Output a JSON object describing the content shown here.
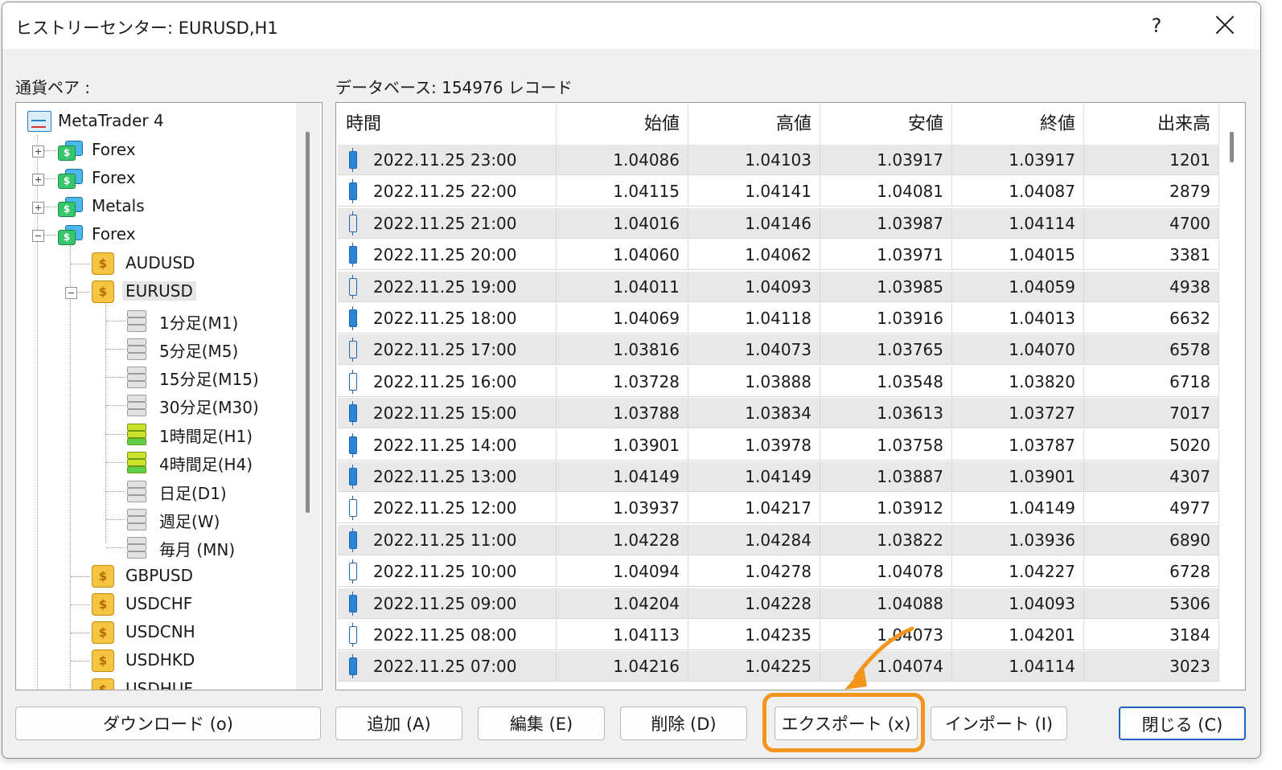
{
  "window": {
    "title": "ヒストリーセンター: EURUSD,H1",
    "help_label": "?",
    "close_icon": "close-icon"
  },
  "left_label": "通貨ペア :",
  "right_label": "データベース: 154976 レコード",
  "tree": {
    "root": "MetaTrader 4",
    "groups": [
      "Forex",
      "Forex",
      "Metals",
      "Forex"
    ],
    "symbols_before": [
      "AUDUSD",
      "EURUSD"
    ],
    "timeframes": [
      "1分足(M1)",
      "5分足(M5)",
      "15分足(M15)",
      "30分足(M30)",
      "1時間足(H1)",
      "4時間足(H4)",
      "日足(D1)",
      "週足(W)",
      "毎月 (MN)"
    ],
    "symbols_after": [
      "GBPUSD",
      "USDCHF",
      "USDCNH",
      "USDHKD",
      "USDHUF"
    ],
    "coin_glyph": "$"
  },
  "grid": {
    "headers": [
      "時間",
      "始値",
      "高値",
      "安値",
      "終値",
      "出来高"
    ],
    "rows": [
      {
        "time": "2022.11.25 23:00",
        "open": "1.04086",
        "high": "1.04103",
        "low": "1.03917",
        "close": "1.03917",
        "volume": "1201"
      },
      {
        "time": "2022.11.25 22:00",
        "open": "1.04115",
        "high": "1.04141",
        "low": "1.04081",
        "close": "1.04087",
        "volume": "2879"
      },
      {
        "time": "2022.11.25 21:00",
        "open": "1.04016",
        "high": "1.04146",
        "low": "1.03987",
        "close": "1.04114",
        "volume": "4700"
      },
      {
        "time": "2022.11.25 20:00",
        "open": "1.04060",
        "high": "1.04062",
        "low": "1.03971",
        "close": "1.04015",
        "volume": "3381"
      },
      {
        "time": "2022.11.25 19:00",
        "open": "1.04011",
        "high": "1.04093",
        "low": "1.03985",
        "close": "1.04059",
        "volume": "4938"
      },
      {
        "time": "2022.11.25 18:00",
        "open": "1.04069",
        "high": "1.04118",
        "low": "1.03916",
        "close": "1.04013",
        "volume": "6632"
      },
      {
        "time": "2022.11.25 17:00",
        "open": "1.03816",
        "high": "1.04073",
        "low": "1.03765",
        "close": "1.04070",
        "volume": "6578"
      },
      {
        "time": "2022.11.25 16:00",
        "open": "1.03728",
        "high": "1.03888",
        "low": "1.03548",
        "close": "1.03820",
        "volume": "6718"
      },
      {
        "time": "2022.11.25 15:00",
        "open": "1.03788",
        "high": "1.03834",
        "low": "1.03613",
        "close": "1.03727",
        "volume": "7017"
      },
      {
        "time": "2022.11.25 14:00",
        "open": "1.03901",
        "high": "1.03978",
        "low": "1.03758",
        "close": "1.03787",
        "volume": "5020"
      },
      {
        "time": "2022.11.25 13:00",
        "open": "1.04149",
        "high": "1.04149",
        "low": "1.03887",
        "close": "1.03901",
        "volume": "4307"
      },
      {
        "time": "2022.11.25 12:00",
        "open": "1.03937",
        "high": "1.04217",
        "low": "1.03912",
        "close": "1.04149",
        "volume": "4977"
      },
      {
        "time": "2022.11.25 11:00",
        "open": "1.04228",
        "high": "1.04284",
        "low": "1.03822",
        "close": "1.03936",
        "volume": "6890"
      },
      {
        "time": "2022.11.25 10:00",
        "open": "1.04094",
        "high": "1.04278",
        "low": "1.04078",
        "close": "1.04227",
        "volume": "6728"
      },
      {
        "time": "2022.11.25 09:00",
        "open": "1.04204",
        "high": "1.04228",
        "low": "1.04088",
        "close": "1.04093",
        "volume": "5306"
      },
      {
        "time": "2022.11.25 08:00",
        "open": "1.04113",
        "high": "1.04235",
        "low": "1.04073",
        "close": "1.04201",
        "volume": "3184"
      },
      {
        "time": "2022.11.25 07:00",
        "open": "1.04216",
        "high": "1.04225",
        "low": "1.04074",
        "close": "1.04114",
        "volume": "3023"
      }
    ]
  },
  "buttons": {
    "download": "ダウンロード (o)",
    "add": "追加 (A)",
    "edit": "編集 (E)",
    "delete": "削除 (D)",
    "export": "エクスポート (x)",
    "import": "インポート (I)",
    "close": "閉じる (C)"
  },
  "colors": {
    "highlight": "#f2951d",
    "accent": "#1f63c6",
    "row_alt": "#e8e8e8"
  }
}
